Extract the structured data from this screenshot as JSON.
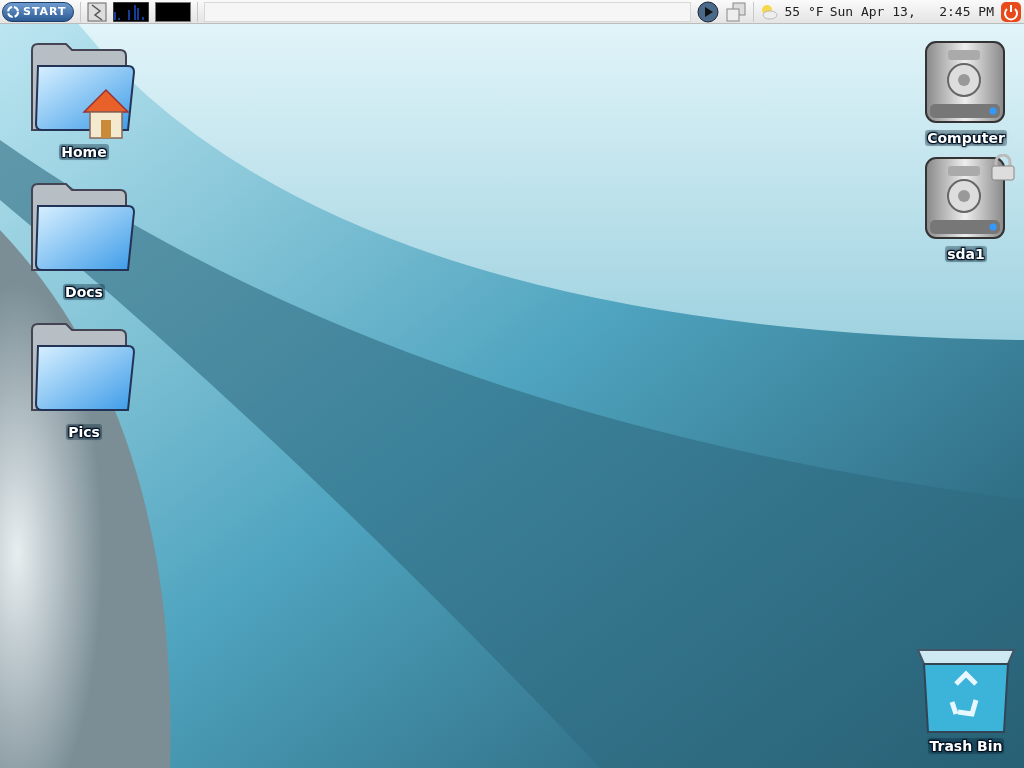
{
  "panel": {
    "start_label": "START",
    "weather": "55 °F",
    "clock": "Sun Apr 13,   2:45 PM"
  },
  "left_icons": [
    {
      "label": "Home",
      "kind": "home-folder"
    },
    {
      "label": "Docs",
      "kind": "folder"
    },
    {
      "label": "Pics",
      "kind": "folder"
    }
  ],
  "right_icons": [
    {
      "label": "Computer",
      "kind": "drive"
    },
    {
      "label": "sda1",
      "kind": "locked-drive"
    }
  ],
  "trash": {
    "label": "Trash Bin"
  }
}
